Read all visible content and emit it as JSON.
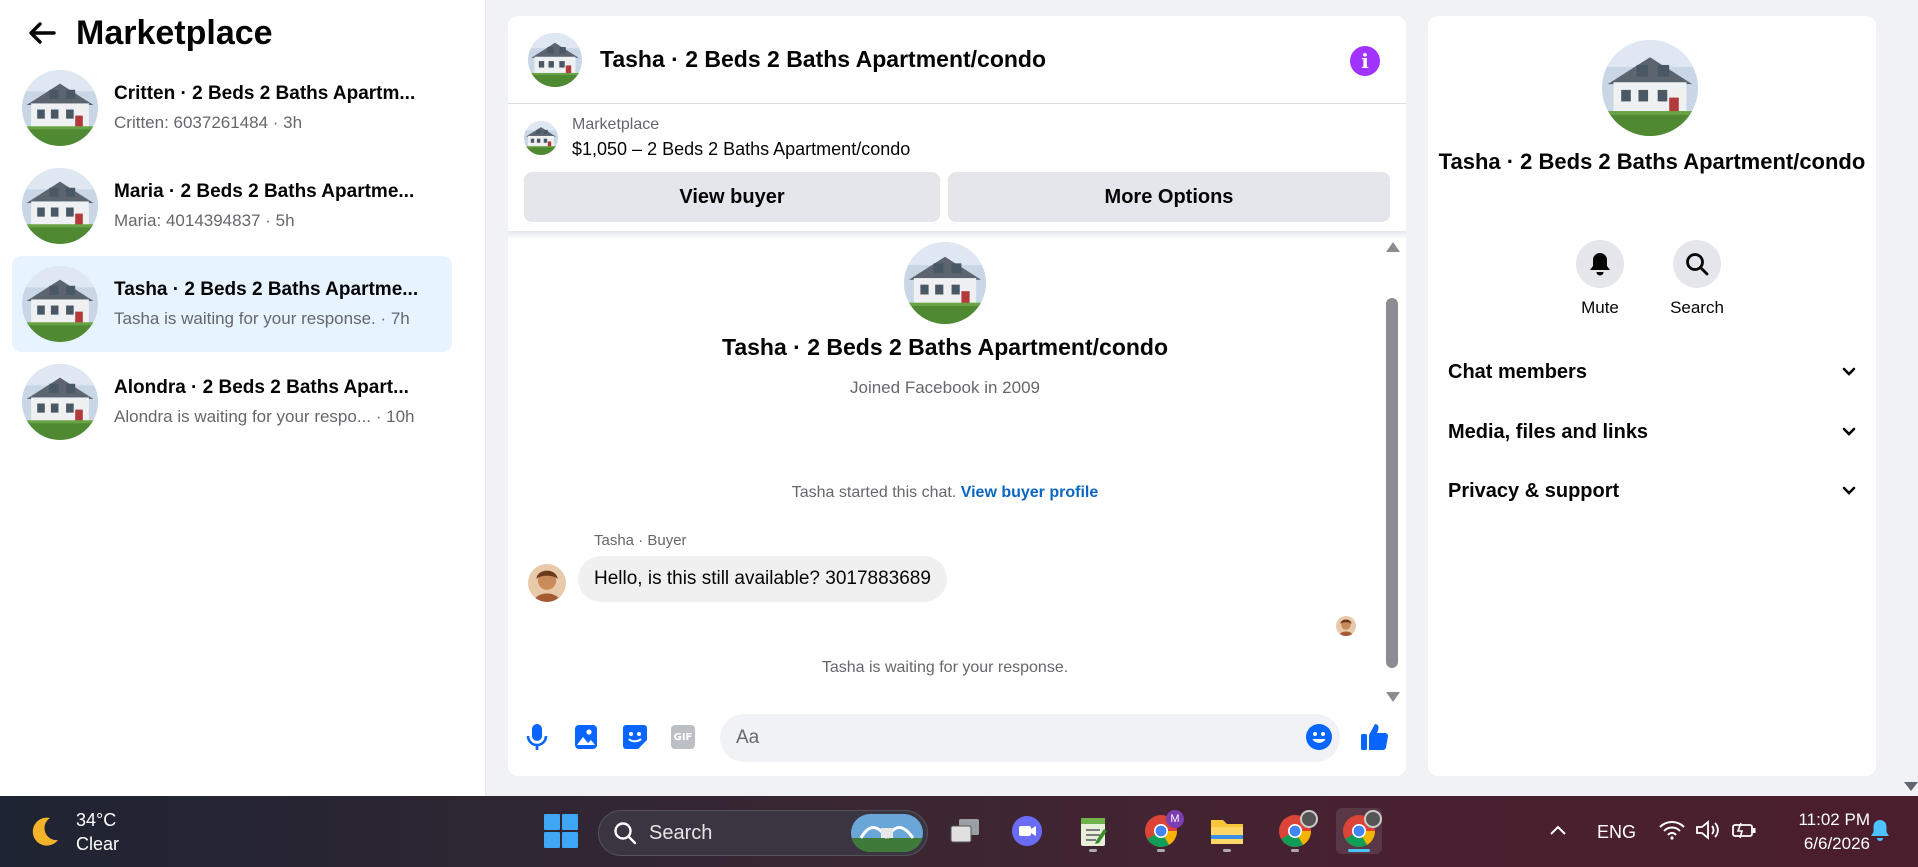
{
  "sidebar": {
    "title": "Marketplace",
    "conversations": [
      {
        "name": "Critten · 2 Beds 2 Baths Apartm...",
        "preview": "Critten: 6037261484 · 3h",
        "active": false
      },
      {
        "name": "Maria · 2 Beds 2 Baths Apartme...",
        "preview": "Maria: 4014394837 · 5h",
        "active": false
      },
      {
        "name": "Tasha · 2 Beds 2 Baths Apartme...",
        "preview": "Tasha is waiting for your response. · 7h",
        "active": true
      },
      {
        "name": "Alondra · 2 Beds 2 Baths Apart...",
        "preview": "Alondra is waiting for your respo...  · 10h",
        "active": false
      }
    ]
  },
  "chat": {
    "title": "Tasha · 2 Beds 2 Baths Apartment/condo",
    "marketplace_label": "Marketplace",
    "listing": "$1,050 – 2 Beds 2 Baths Apartment/condo",
    "view_buyer_label": "View buyer",
    "more_options_label": "More Options",
    "profile_name": "Tasha · 2 Beds 2 Baths Apartment/condo",
    "joined": "Joined Facebook in 2009",
    "started_text": "Tasha started this chat.",
    "view_profile_link": "View buyer profile",
    "sender_label": "Tasha · Buyer",
    "message": "Hello, is this still available? 3017883689",
    "waiting": "Tasha is waiting for your response.",
    "input_placeholder": "Aa",
    "gif_label": "GIF"
  },
  "right_panel": {
    "name": "Tasha · 2 Beds 2 Baths Apartment/condo",
    "mute_label": "Mute",
    "search_label": "Search",
    "sections": [
      "Chat members",
      "Media, files and links",
      "Privacy & support"
    ]
  },
  "taskbar": {
    "temperature": "34°C",
    "condition": "Clear",
    "search_label": "Search",
    "language": "ENG",
    "time": "11:02 PM",
    "date": "6/6/2026",
    "profile_badge": "M"
  },
  "colors": {
    "accent_blue": "#0866ff",
    "info_purple": "#a033ff",
    "active_conversation": "#e7f3ff",
    "link_blue": "#0a66c2"
  }
}
